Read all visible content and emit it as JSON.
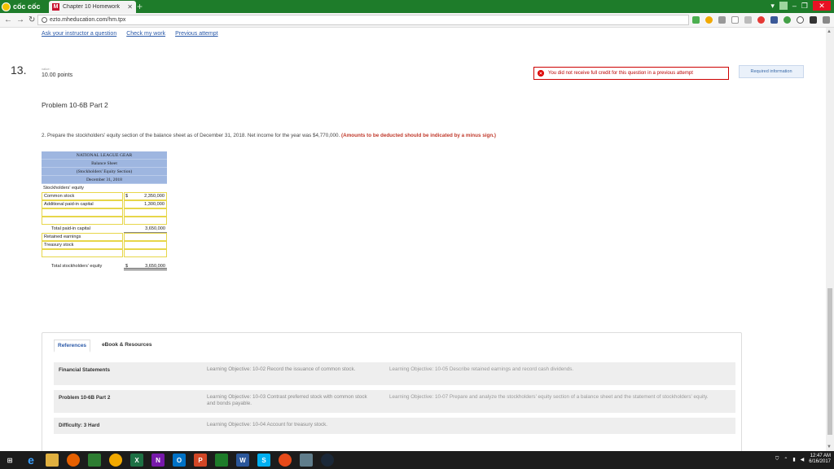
{
  "browser": {
    "brand": "cốc cốc",
    "tab_title": "Chapter 10 Homework",
    "tab_favicon": "M",
    "url": "ezto.mheducation.com/hm.tpx"
  },
  "top_links": [
    "Ask your instructor a question",
    "Check my work",
    "Previous attempt"
  ],
  "question": {
    "number": "13.",
    "value_label": "value:",
    "points": "10.00 points",
    "warning": "You did not receive full credit for this question in a previous attempt",
    "required_info": "Required information",
    "title": "Problem 10-6B Part 2",
    "instruction": "2. Prepare the stockholders' equity section of the balance sheet as of December 31, 2018. Net income for the year was $4,770,000.",
    "instruction_hint": "(Amounts to be deducted should be indicated by a minus sign.)"
  },
  "sheet": {
    "header": [
      "NATIONAL LEAGUE GEAR",
      "Balance Sheet",
      "(Stockholders' Equity Section)",
      "December 31, 2018"
    ],
    "section_label": "Stockholders' equity",
    "common_stock_label": "Common stock",
    "common_stock_currency": "$",
    "common_stock_value": "2,350,000",
    "apic_label": "Additional paid-in capital",
    "apic_value": "1,300,000",
    "total_paid_in_label": "Total paid-in capital",
    "total_paid_in_value": "3,650,000",
    "retained_label": "Retained earnings",
    "treasury_label": "Treasury stock",
    "total_equity_label": "Total stockholders' equity",
    "total_equity_currency": "$",
    "total_equity_value": "3,650,000"
  },
  "references": {
    "tabs": [
      "References",
      "eBook & Resources"
    ],
    "rows": [
      {
        "name": "Financial Statements",
        "lo1": "Learning Objective: 10-02 Record the issuance of common stock.",
        "lo2": "Learning Objective: 10-05 Describe retained earnings and record cash dividends."
      },
      {
        "name": "Problem 10-6B Part 2",
        "lo1": "Learning Objective: 10-03 Contrast preferred stock with common stock and bonds payable.",
        "lo2": "Learning Objective: 10-07 Prepare and analyze the stockholders' equity section of a balance sheet and the statement of stockholders' equity."
      },
      {
        "name": "Difficulty: 3 Hard",
        "lo1": "Learning Objective: 10-04 Account for treasury stock.",
        "lo2": ""
      }
    ]
  },
  "taskbar": {
    "time": "12:47 AM",
    "date": "6/16/2017"
  }
}
